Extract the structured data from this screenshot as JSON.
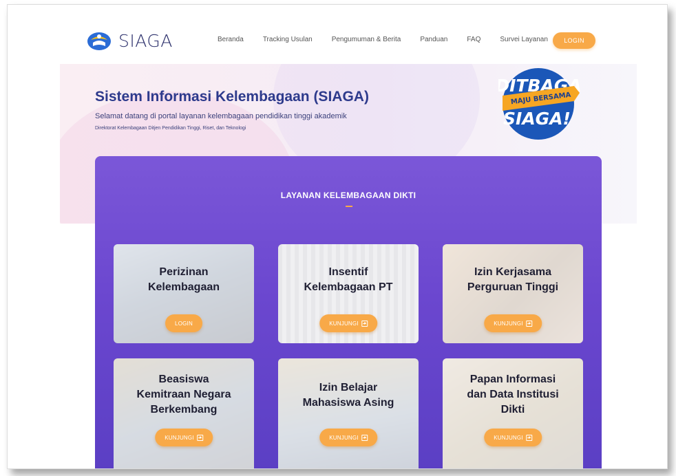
{
  "brand": {
    "name": "SIAGA"
  },
  "nav": {
    "items": [
      "Beranda",
      "Tracking Usulan",
      "Pengumuman & Berita",
      "Panduan",
      "FAQ",
      "Survei Layanan"
    ],
    "login_label": "LOGIN"
  },
  "hero": {
    "title": "Sistem Informasi Kelembagaan (SIAGA)",
    "subtitle": "Selamat datang di portal layanan kelembagaan pendidikan tinggi akademik",
    "org": "Direktorat Kelembagaan Ditjen Pendidikan Tinggi, Riset, dan Teknologi",
    "badge": {
      "line1": "DITBAGA",
      "ribbon": "MAJU BERSAMA",
      "line2": "SIAGA!"
    }
  },
  "services": {
    "title": "LAYANAN KELEMBAGAAN DIKTI",
    "cards": [
      {
        "title_lines": [
          "Perizinan",
          "Kelembagaan"
        ],
        "button": "LOGIN"
      },
      {
        "title_lines": [
          "Insentif",
          "Kelembagaan PT"
        ],
        "button": "KUNJUNGI"
      },
      {
        "title_lines": [
          "Izin Kerjasama",
          "Perguruan Tinggi"
        ],
        "button": "KUNJUNGI"
      },
      {
        "title_lines": [
          "Beasiswa",
          "Kemitraan Negara",
          "Berkembang"
        ],
        "button": "KUNJUNGI"
      },
      {
        "title_lines": [
          "Izin Belajar",
          "Mahasiswa Asing"
        ],
        "button": "KUNJUNGI"
      },
      {
        "title_lines": [
          "Papan Informasi",
          "dan Data Institusi",
          "Dikti"
        ],
        "button": "KUNJUNGI"
      }
    ]
  },
  "colors": {
    "accent": "#f8a948",
    "primary": "#2d3a8c",
    "panel": "#6b47cf"
  }
}
